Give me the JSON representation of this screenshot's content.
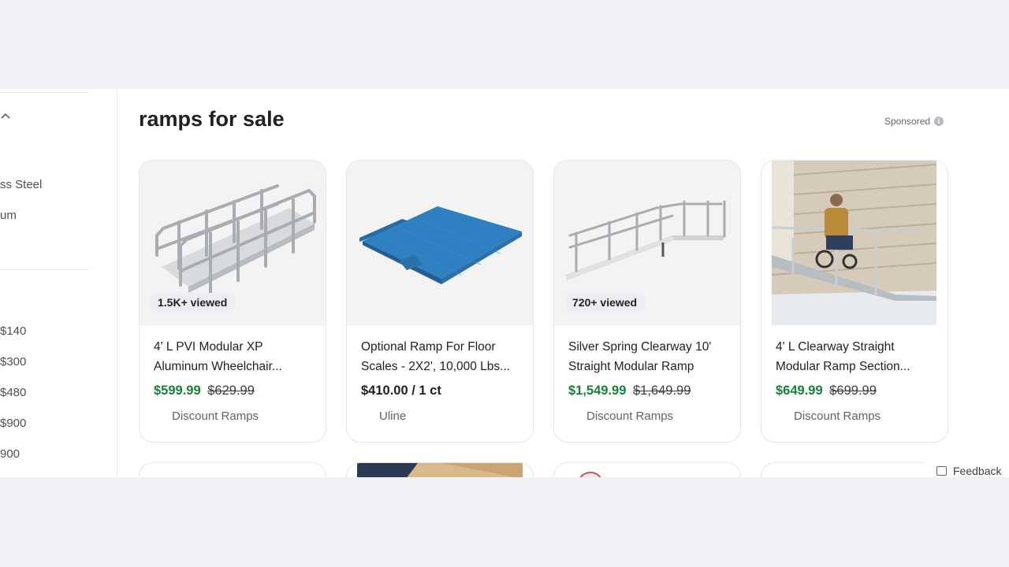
{
  "sidebar": {
    "materials": [
      "ss Steel",
      "um"
    ],
    "prices": [
      "$140",
      "$300",
      "$480",
      "$900",
      "900"
    ]
  },
  "heading": {
    "title": "ramps for sale",
    "sponsored": "Sponsored"
  },
  "products": [
    {
      "badge": "1.5K+ viewed",
      "name_line1": "4' L PVI Modular XP",
      "name_line2": "Aluminum Wheelchair...",
      "price": "$599.99",
      "old_price": "$629.99",
      "seller": "Discount Ramps"
    },
    {
      "badge": "",
      "name_line1": "Optional Ramp For Floor",
      "name_line2": "Scales - 2X2', 10,000 Lbs...",
      "price": "$410.00 / 1 ct",
      "old_price": "",
      "seller": "Uline"
    },
    {
      "badge": "720+ viewed",
      "name_line1": "Silver Spring Clearway 10'",
      "name_line2": "Straight Modular Ramp",
      "price": "$1,549.99",
      "old_price": "$1,649.99",
      "seller": "Discount Ramps"
    },
    {
      "badge": "",
      "name_line1": "4' L Clearway Straight",
      "name_line2": "Modular Ramp Section...",
      "price": "$649.99",
      "old_price": "$699.99",
      "seller": "Discount Ramps"
    }
  ],
  "feedback": "Feedback",
  "colors": {
    "sale_price": "#188038",
    "ramp_blue": "#2f7fc1"
  }
}
